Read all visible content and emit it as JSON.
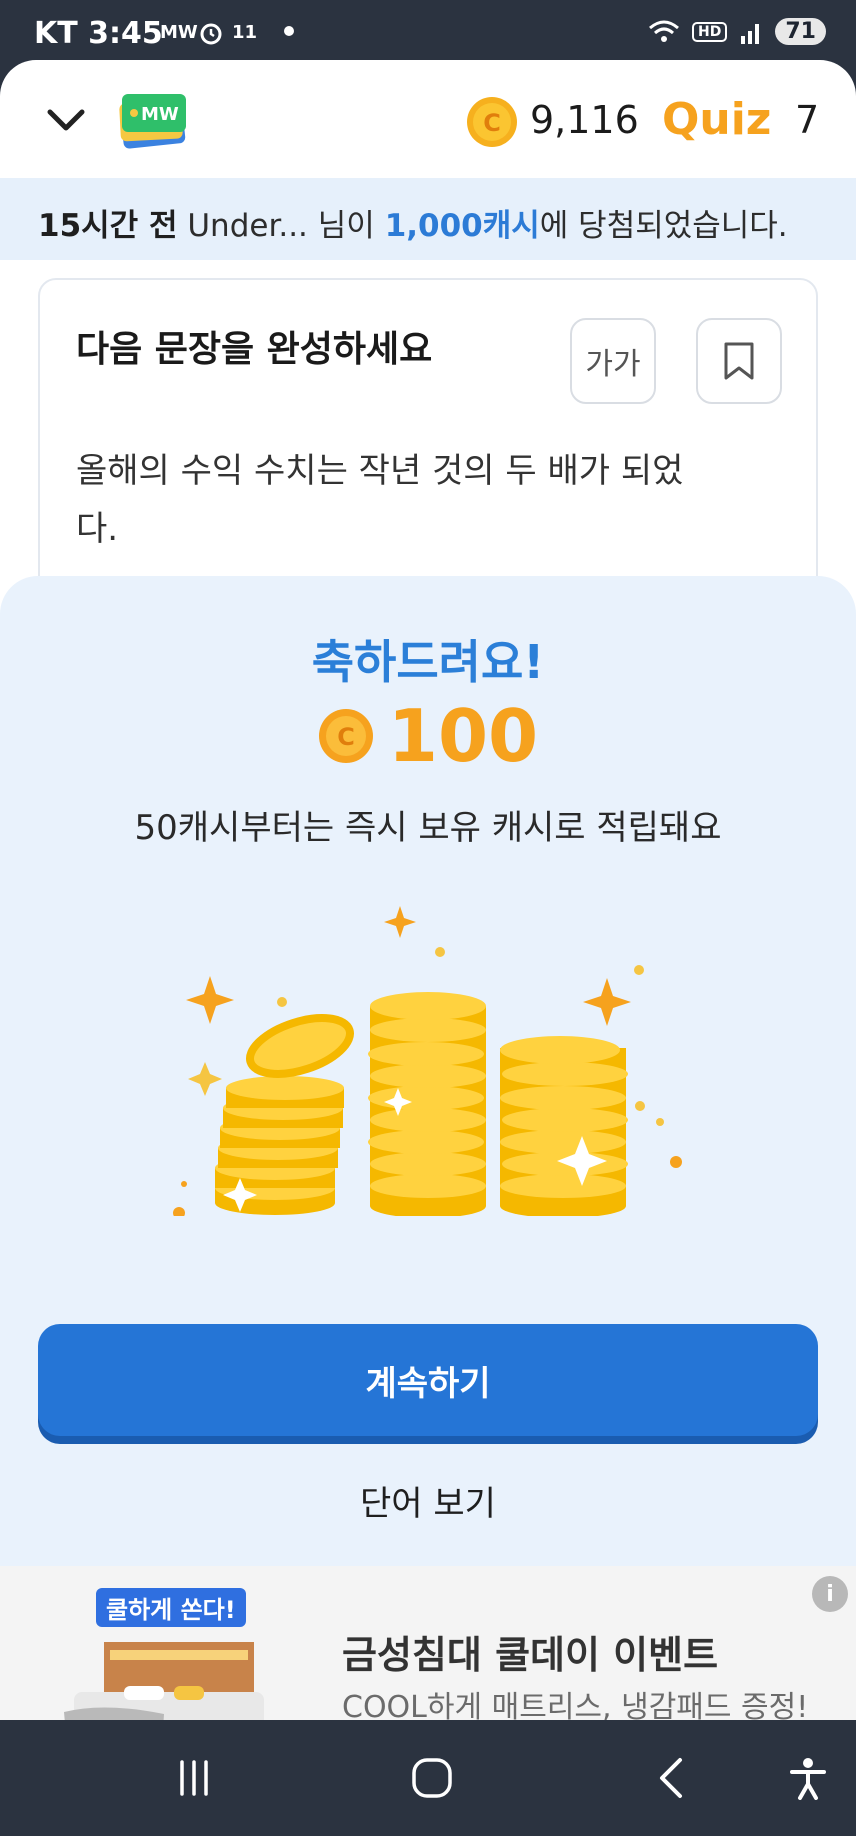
{
  "status_bar": {
    "carrier": "KT",
    "time": "3:45",
    "app_label": "MW",
    "alarm_label": "11",
    "battery": "71"
  },
  "header": {
    "logo_text": "MW",
    "cash_balance": "9,116",
    "quiz_label": "Quiz",
    "quiz_count": "7"
  },
  "ticker": {
    "time_ago": "15시간 전",
    "user": "Under...",
    "mid": "님이",
    "amount": "1,000캐시",
    "suffix": "에 당첨되었습니다."
  },
  "question": {
    "title": "다음 문장을 완성하세요",
    "font_size_label": "가가",
    "sentence": "올해의 수익 수치는 작년 것의 두 배가 되었다."
  },
  "reward": {
    "congrats": "축하드려요!",
    "amount": "100",
    "subtext": "50캐시부터는 즉시 보유 캐시로 적립돼요",
    "continue_label": "계속하기",
    "view_word_label": "단어 보기"
  },
  "ad": {
    "badge": "쿨하게 쏜다!",
    "title": "금성침대 쿨데이 이벤트",
    "subtitle": "COOL하게 매트리스, 냉감패드 증정!",
    "info_icon": "i"
  },
  "colors": {
    "primary_blue": "#2575d6",
    "coin_orange": "#f6a21e",
    "sheet_bg": "#e9f2fc",
    "ticker_bg": "#e6f0fb"
  },
  "icons": [
    "chevron-down-icon",
    "coin-icon",
    "bookmark-icon",
    "info-icon",
    "recent-apps-icon",
    "home-icon",
    "back-icon",
    "accessibility-icon"
  ]
}
